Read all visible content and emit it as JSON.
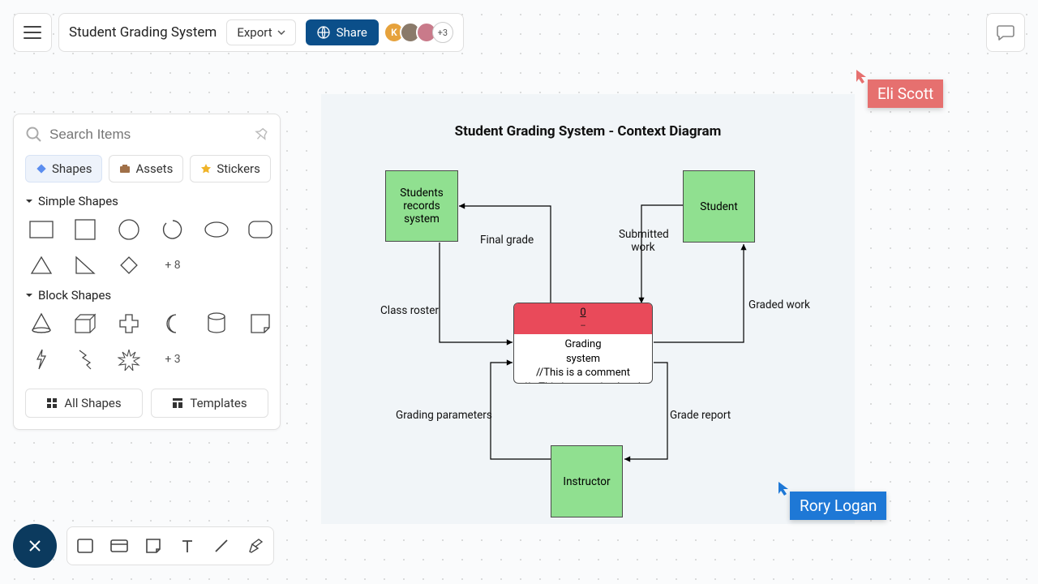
{
  "header": {
    "title": "Student Grading System",
    "export_label": "Export",
    "share_label": "Share",
    "avatar_more": "+3"
  },
  "search": {
    "placeholder": "Search Items"
  },
  "tabs": {
    "shapes": "Shapes",
    "assets": "Assets",
    "stickers": "Stickers"
  },
  "sections": {
    "simple": "Simple Shapes",
    "simple_more": "+ 8",
    "block": "Block Shapes",
    "block_more": "+ 3"
  },
  "panel_buttons": {
    "all_shapes": "All Shapes",
    "templates": "Templates"
  },
  "diagram": {
    "title": "Student Grading System - Context Diagram",
    "nodes": {
      "records": "Students\nrecords\nsystem",
      "student": "Student",
      "instructor": "Instructor",
      "center_head_0": "0",
      "center_head_dash": "--",
      "center_l1": "Grading",
      "center_l2": "system",
      "center_l3": "//This is a comment",
      "center_l4": "// --This is a section break"
    },
    "edges": {
      "final_grade": "Final grade",
      "class_roster": "Class roster",
      "submitted_work": "Submitted\nwork",
      "graded_work": "Graded work",
      "grading_params": "Grading parameters",
      "grade_report": "Grade report"
    }
  },
  "cursors": {
    "eli": "Eli Scott",
    "rory": "Rory Logan"
  }
}
